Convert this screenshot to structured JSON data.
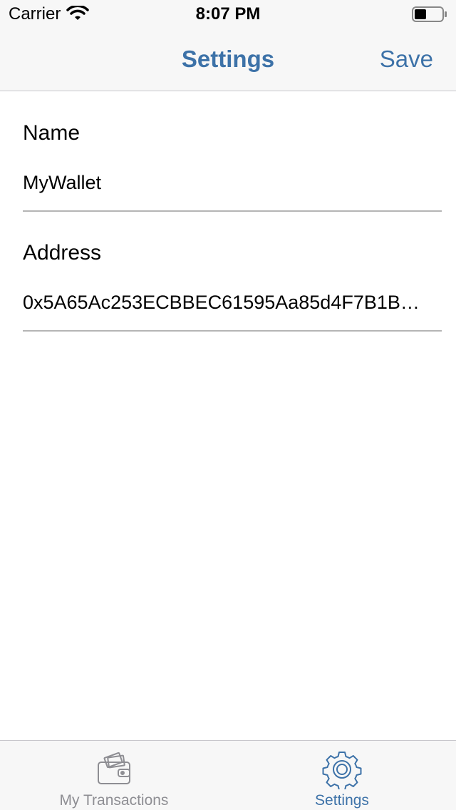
{
  "status_bar": {
    "carrier": "Carrier",
    "time": "8:07 PM",
    "wifi_icon": "wifi-icon",
    "battery_icon": "battery-icon"
  },
  "nav": {
    "title": "Settings",
    "save_label": "Save"
  },
  "form": {
    "name": {
      "label": "Name",
      "value": "MyWallet"
    },
    "address": {
      "label": "Address",
      "value": "0x5A65Ac253ECBBEC61595Aa85d4F7B1B…"
    }
  },
  "tabs": [
    {
      "label": "My Transactions",
      "icon": "wallet-icon",
      "selected": false
    },
    {
      "label": "Settings",
      "icon": "gear-icon",
      "selected": true
    }
  ],
  "colors": {
    "accent": "#3d72a8",
    "inactive": "#8e8e93",
    "bar_background": "#f7f7f7"
  }
}
